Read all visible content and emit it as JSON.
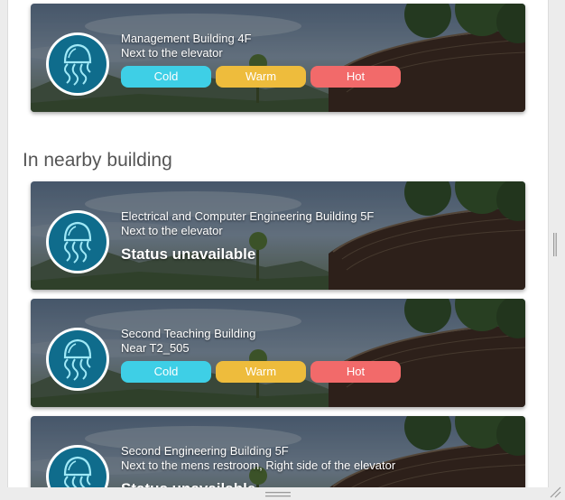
{
  "colors": {
    "cold": "#3ecfe6",
    "warm": "#eebc3c",
    "hot": "#f26a6a",
    "logo_ring": "#0f6c8c"
  },
  "section_title": "In nearby building",
  "cards": [
    {
      "building": "Management Building 4F",
      "location": "Next to the elevator",
      "buttons": {
        "cold": "Cold",
        "warm": "Warm",
        "hot": "Hot"
      }
    },
    {
      "building": "Electrical and Computer Engineering Building 5F",
      "location": "Next to the elevator",
      "status": "Status unavailable"
    },
    {
      "building": "Second Teaching Building",
      "location": "Near T2_505",
      "buttons": {
        "cold": "Cold",
        "warm": "Warm",
        "hot": "Hot"
      }
    },
    {
      "building": "Second Engineering Building 5F",
      "location": "Next to the mens restroom, Right side of the elevator",
      "status": "Status unavailable"
    }
  ]
}
